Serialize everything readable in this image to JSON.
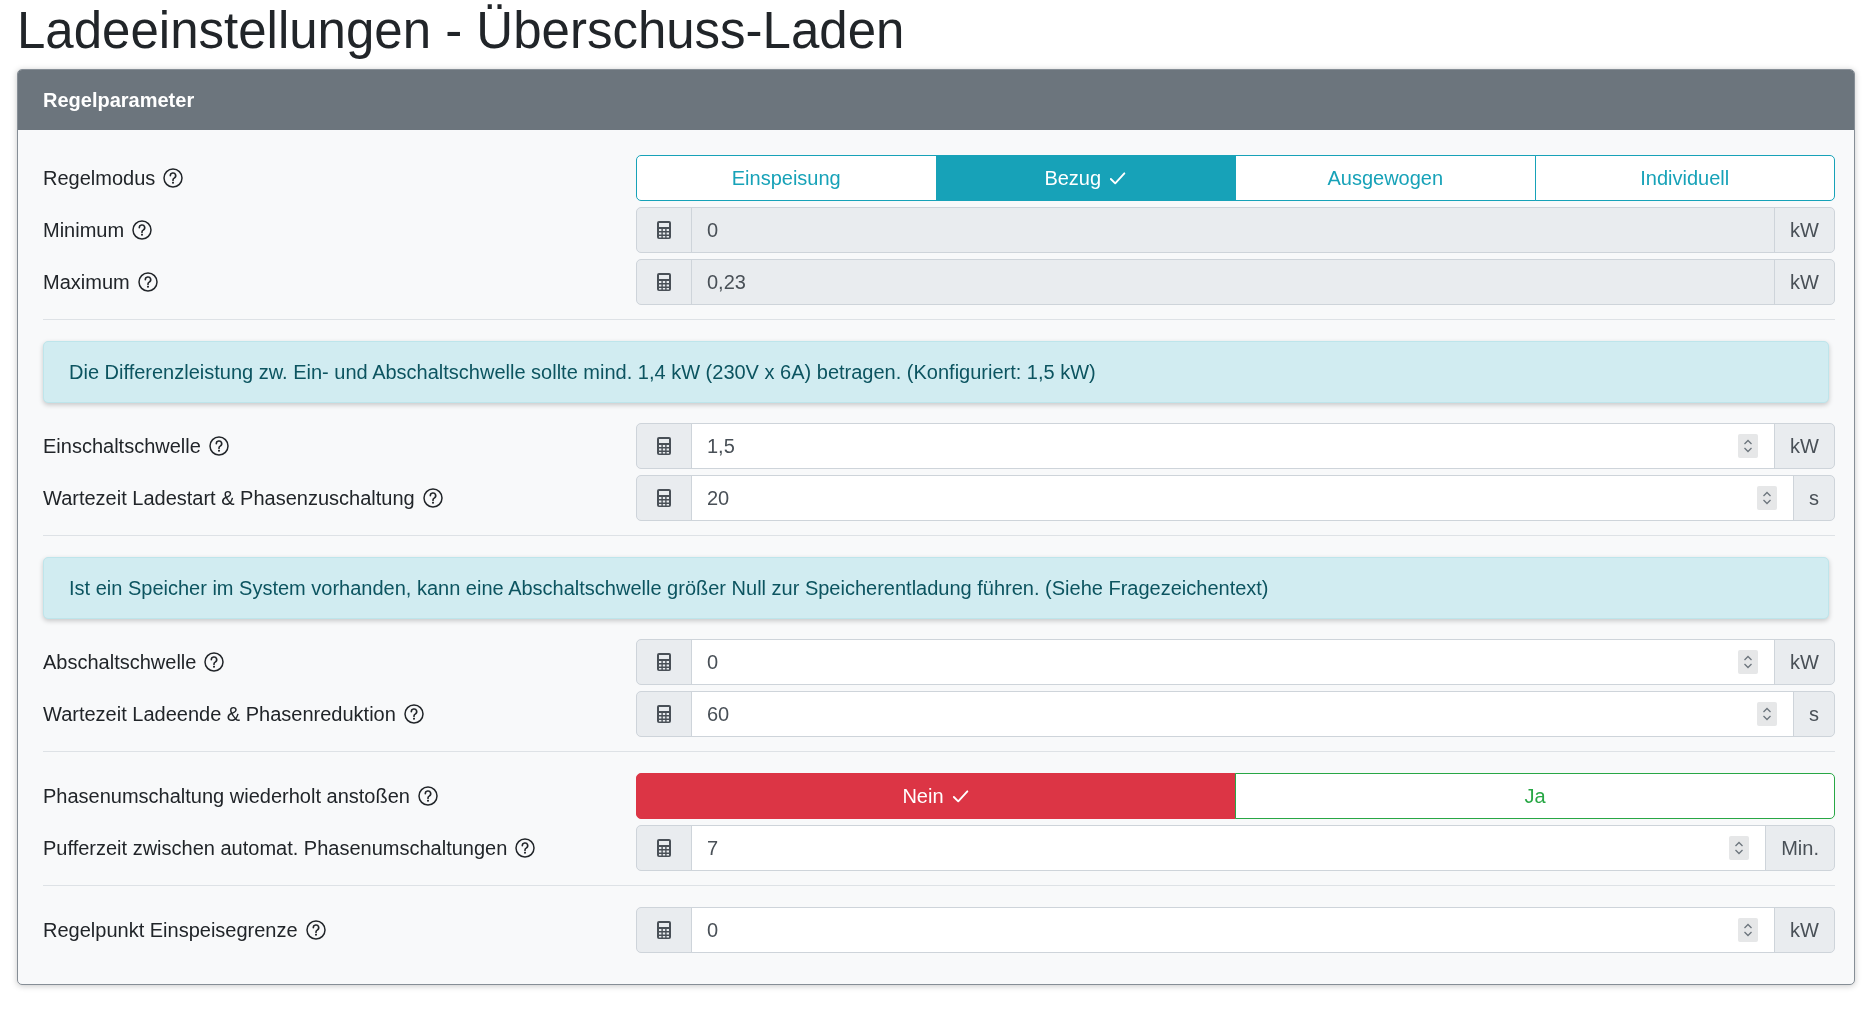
{
  "page_title": "Ladeeinstellungen - Überschuss-Laden",
  "card": {
    "title": "Regelparameter",
    "sections": [
      {
        "rows": [
          {
            "kind": "toggle",
            "label": "Regelmodus",
            "options": [
              {
                "label": "Einspeisung",
                "selected": false
              },
              {
                "label": "Bezug",
                "selected": true
              },
              {
                "label": "Ausgewogen",
                "selected": false
              },
              {
                "label": "Individuell",
                "selected": false
              }
            ]
          },
          {
            "kind": "number",
            "label": "Minimum",
            "value": "0",
            "unit": "kW",
            "readonly": true
          },
          {
            "kind": "number",
            "label": "Maximum",
            "value": "0,23",
            "unit": "kW",
            "readonly": true
          }
        ]
      },
      {
        "notice": "Die Differenzleistung zw. Ein- und Abschaltschwelle sollte mind. 1,4 kW (230V x 6A) betragen. (Konfiguriert: 1,5 kW)",
        "rows": [
          {
            "kind": "number",
            "label": "Einschaltschwelle",
            "value": "1,5",
            "unit": "kW",
            "readonly": false
          },
          {
            "kind": "number",
            "label": "Wartezeit Ladestart & Phasenzuschaltung",
            "value": "20",
            "unit": "s",
            "readonly": false
          }
        ]
      },
      {
        "notice": "Ist ein Speicher im System vorhanden, kann eine Abschaltschwelle größer Null zur Speicherentladung führen. (Siehe Fragezeichentext)",
        "rows": [
          {
            "kind": "number",
            "label": "Abschaltschwelle",
            "value": "0",
            "unit": "kW",
            "readonly": false
          },
          {
            "kind": "number",
            "label": "Wartezeit Ladeende & Phasenreduktion",
            "value": "60",
            "unit": "s",
            "readonly": false
          }
        ]
      },
      {
        "rows": [
          {
            "kind": "toggle",
            "label": "Phasenumschaltung wiederholt anstoßen",
            "options": [
              {
                "label": "Nein",
                "selected": true,
                "color": "#dc3545"
              },
              {
                "label": "Ja",
                "selected": false,
                "color": "#28a745"
              }
            ]
          },
          {
            "kind": "number",
            "label": "Pufferzeit zwischen automat. Phasenumschaltungen",
            "value": "7",
            "unit": "Min.",
            "readonly": false
          }
        ]
      },
      {
        "rows": [
          {
            "kind": "number",
            "label": "Regelpunkt Einspeisegrenze",
            "value": "0",
            "unit": "kW",
            "readonly": false
          }
        ]
      }
    ]
  }
}
